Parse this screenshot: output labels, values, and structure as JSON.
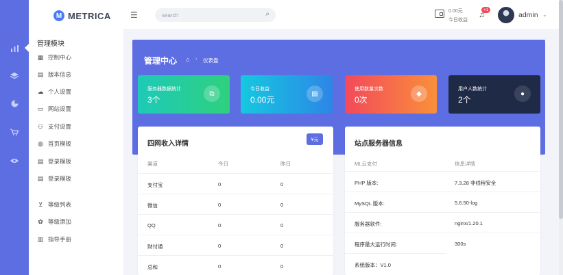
{
  "rail": {
    "icons": [
      "chart-icon",
      "layers-icon",
      "pie-icon",
      "cart-icon",
      "eye-icon"
    ]
  },
  "brand": {
    "logo_glyph": "M",
    "name": "METRICA"
  },
  "sidebar": {
    "section_title": "管理模块",
    "items": [
      {
        "label": "控制中心",
        "icon": "grid-icon"
      },
      {
        "label": "版本信息",
        "icon": "doc-icon"
      },
      {
        "label": "个人设置",
        "icon": "cloud-icon"
      },
      {
        "label": "网站设置",
        "icon": "card-icon"
      },
      {
        "label": "支付设置",
        "icon": "users-icon"
      },
      {
        "label": "首页模板",
        "icon": "globe-icon"
      },
      {
        "label": "登录模板",
        "icon": "doc-icon"
      },
      {
        "label": "登录模板",
        "icon": "doc-icon"
      },
      {
        "label": "等级列表",
        "icon": "cart-icon"
      },
      {
        "label": "等级添加",
        "icon": "settings-icon"
      },
      {
        "label": "指导手册",
        "icon": "book-icon"
      }
    ]
  },
  "header": {
    "search_placeholder": "search",
    "earnings_amount": "0.00元",
    "earnings_label": "今日收益",
    "notification_badge": "+1",
    "user_name": "admin"
  },
  "banner": {
    "title": "管理中心",
    "breadcrumb": "仪表盘"
  },
  "stats": [
    {
      "label": "服务器数据统计",
      "value": "3个",
      "color_from": "#1ecab8",
      "color_to": "#2fd07e",
      "icon": "copy-icon",
      "glyph": "⧉"
    },
    {
      "label": "今日收益",
      "value": "0.00元",
      "color_from": "#15c8e0",
      "color_to": "#2d86e6",
      "icon": "money-icon",
      "glyph": "▤"
    },
    {
      "label": "使用数量次数",
      "value": "0次",
      "color_from": "#f3495b",
      "color_to": "#f9903a",
      "icon": "tag-icon",
      "glyph": "◆"
    },
    {
      "label": "用户人数统计",
      "value": "2个",
      "color_from": "#1e2a46",
      "color_to": "#1e2a46",
      "icon": "user-icon",
      "glyph": "●"
    }
  ],
  "income": {
    "title": "四网收入详情",
    "currency_button": "¥元",
    "headers": [
      "渠道",
      "今日",
      "昨日"
    ],
    "rows": [
      [
        "支付宝",
        "0",
        "0"
      ],
      [
        "微信",
        "0",
        "0"
      ],
      [
        "QQ",
        "0",
        "0"
      ],
      [
        "财付通",
        "0",
        "0"
      ],
      [
        "总和",
        "0",
        "0"
      ]
    ]
  },
  "server": {
    "title": "站点服务器信息",
    "headers": [
      "ML云支付",
      "信息详情"
    ],
    "rows": [
      [
        "PHP 版本:",
        "7.3.28 非线程安全"
      ],
      [
        "MySQL 版本:",
        "5.6.50-log"
      ],
      [
        "服务器软件:",
        "nginx/1.20.1"
      ],
      [
        "程序最大运行时间:",
        "300s"
      ],
      [
        "系统版本：V1.0",
        ""
      ]
    ]
  }
}
